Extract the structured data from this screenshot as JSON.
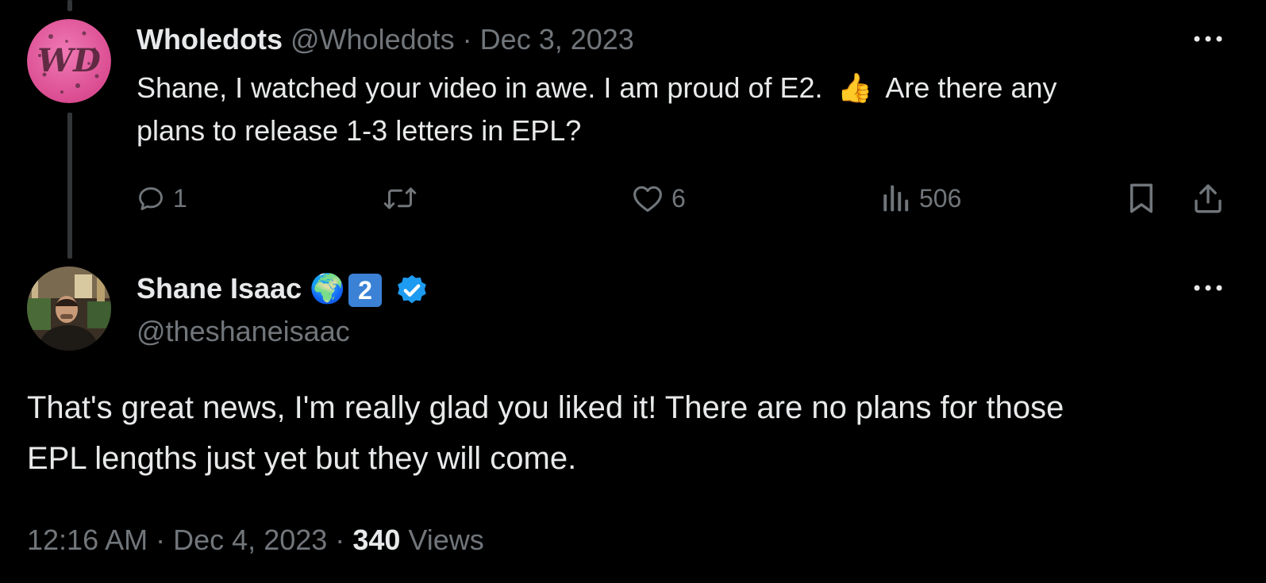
{
  "parent_tweet": {
    "display_name": "Wholedots",
    "handle": "@Wholedots",
    "separator": "·",
    "date": "Dec 3, 2023",
    "text_line1": "Shane, I watched your video in awe.  I am proud of E2.",
    "emoji": "👍",
    "text_line1_end": "Are there any",
    "text_line2": "plans to release 1-3 letters in EPL?",
    "avatar_text": "WD",
    "actions": {
      "reply_count": "1",
      "retweet_count": "",
      "like_count": "6",
      "views_count": "506"
    }
  },
  "reply_tweet": {
    "display_name": "Shane Isaac",
    "name_emoji": "🌍",
    "name_badge": "2",
    "handle": "@theshaneisaac",
    "text_line1": "That's great news, I'm really glad you liked it! There are no plans for those",
    "text_line2": "EPL lengths just yet but they will come.",
    "time": "12:16 AM",
    "separator": "·",
    "date": "Dec 4, 2023",
    "views_count": "340",
    "views_label": "Views"
  },
  "colors": {
    "background": "#000000",
    "text_primary": "#e7e9ea",
    "text_secondary": "#71767b",
    "thread_line": "#333639",
    "verified_blue": "#1d9bf0",
    "avatar_pink": "#e05a9c"
  }
}
